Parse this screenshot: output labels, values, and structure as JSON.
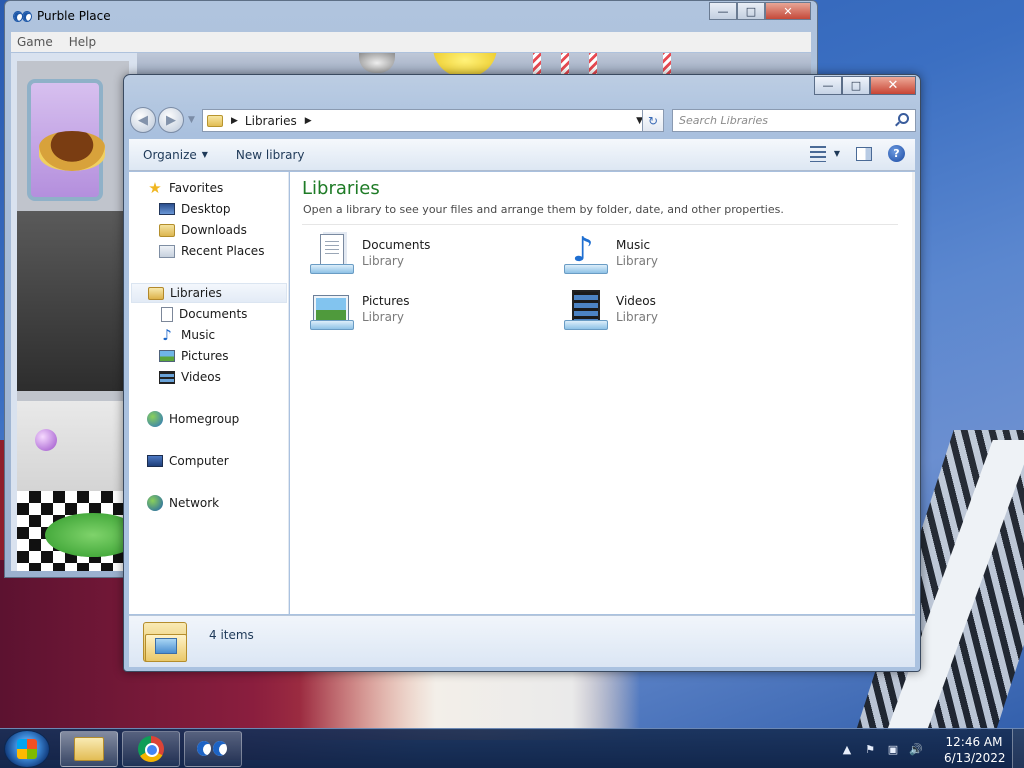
{
  "purble_window": {
    "title": "Purble Place",
    "menu": [
      "Game",
      "Help"
    ],
    "controls": {
      "minimize": "—",
      "maximize": "□",
      "close": "✕"
    }
  },
  "explorer": {
    "controls": {
      "minimize": "—",
      "maximize": "□",
      "close": "✕"
    },
    "nav": {
      "back": "◀",
      "forward": "▶",
      "recent_arrow": "▼"
    },
    "address": {
      "crumb_sep": "▶",
      "crumbs": [
        "Libraries"
      ],
      "trailing_sep": "▶",
      "dropdown": "▼",
      "refresh": "↻"
    },
    "search": {
      "placeholder": "Search Libraries"
    },
    "toolbar": {
      "organize": "Organize",
      "organize_arrow": "▼",
      "new_library": "New library",
      "view_arrow": "▼",
      "help": "?"
    },
    "nav_pane": {
      "favorites": "Favorites",
      "favorites_items": [
        "Desktop",
        "Downloads",
        "Recent Places"
      ],
      "libraries": "Libraries",
      "libraries_items": [
        "Documents",
        "Music",
        "Pictures",
        "Videos"
      ],
      "homegroup": "Homegroup",
      "computer": "Computer",
      "network": "Network"
    },
    "content": {
      "title": "Libraries",
      "subtitle": "Open a library to see your files and arrange them by folder, date, and other properties.",
      "tiles": [
        {
          "name": "Documents",
          "type": "Library",
          "icon": "documents-library-icon"
        },
        {
          "name": "Music",
          "type": "Library",
          "icon": "music-library-icon"
        },
        {
          "name": "Pictures",
          "type": "Library",
          "icon": "pictures-library-icon"
        },
        {
          "name": "Videos",
          "type": "Library",
          "icon": "videos-library-icon"
        }
      ]
    },
    "details": {
      "count": "4 items"
    }
  },
  "taskbar": {
    "tasks": [
      "Windows Explorer",
      "Google Chrome",
      "Purble Place"
    ],
    "tray": {
      "show_hidden": "▲",
      "clock_time": "12:46 AM",
      "clock_date": "6/13/2022"
    }
  }
}
